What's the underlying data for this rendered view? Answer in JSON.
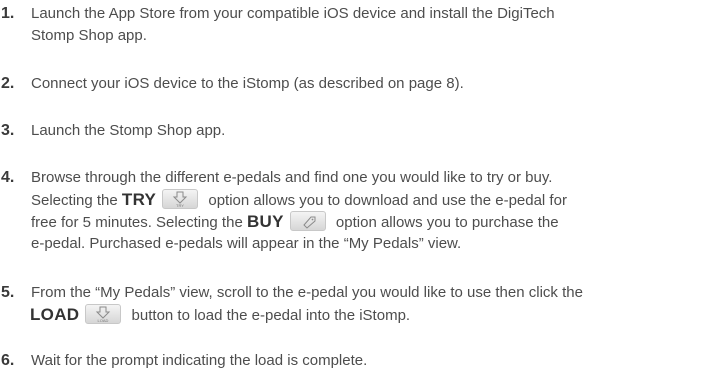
{
  "steps": [
    {
      "num": "1.",
      "lines": [
        "Launch the App Store from your compatible iOS device and install the DigiTech",
        "Stomp Shop app."
      ]
    },
    {
      "num": "2.",
      "lines": [
        "Connect your iOS device to the iStomp (as described on page 8)."
      ]
    },
    {
      "num": "3.",
      "lines": [
        "Launch the Stomp Shop app."
      ]
    },
    {
      "num": "4.",
      "line1": "Browse through the different e-pedals and find one you would like to try or buy.",
      "line2_pre": "Selecting the",
      "try_label": "TRY",
      "line2_post": "option allows you to download and use the e-pedal for",
      "line3_pre": "free for 5 minutes. Selecting the",
      "buy_label": "BUY",
      "line3_post": "option allows you to purchase the",
      "line4": "e-pedal. Purchased e-pedals will appear in the “My Pedals” view."
    },
    {
      "num": "5.",
      "line1": "From the “My Pedals” view, scroll to the e-pedal you would like to use then click the",
      "load_label": "LOAD",
      "line2_post": "button to load the e-pedal into the iStomp."
    },
    {
      "num": "6.",
      "lines": [
        "Wait for the prompt indicating the load is complete."
      ]
    }
  ],
  "icons": {
    "try": "try-download-icon",
    "buy": "buy-tag-icon",
    "load": "load-download-icon"
  },
  "icon_labels": {
    "try": "TRY",
    "load": "LOAD"
  }
}
